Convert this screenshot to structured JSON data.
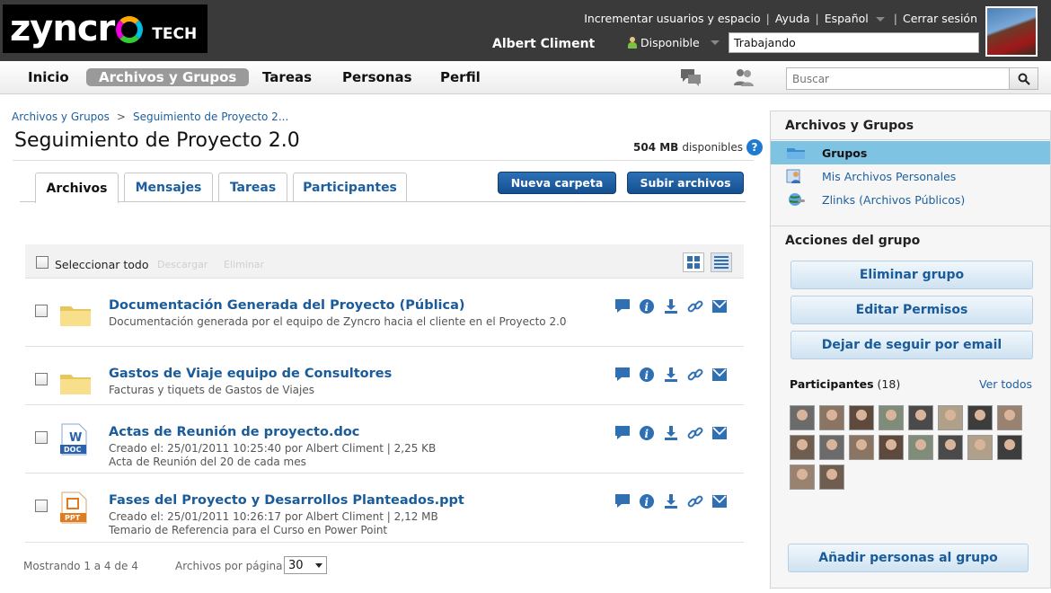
{
  "brand": {
    "logo_text": "zyncro",
    "logo_suffix": "TECH"
  },
  "header": {
    "user_name": "Albert Climent",
    "links": [
      "Incrementar usuarios y espacio",
      "Ayuda",
      "Español",
      "Cerrar sesión"
    ],
    "status_label": "Disponible",
    "status_value": "Trabajando"
  },
  "nav": {
    "items": [
      "Inicio",
      "Archivos y Grupos",
      "Tareas",
      "Personas",
      "Perfil"
    ],
    "active": "Archivos y Grupos",
    "search_placeholder": "Buscar"
  },
  "main": {
    "breadcrumb": [
      "Archivos y Grupos",
      "Seguimiento de Proyecto 2..."
    ],
    "title": "Seguimiento de Proyecto 2.0",
    "space_value": "504 MB",
    "space_label": "disponibles",
    "tabs": [
      "Archivos",
      "Mensajes",
      "Tareas",
      "Participantes"
    ],
    "buttons": {
      "new_folder": "Nueva carpeta",
      "upload": "Subir archivos"
    },
    "toolbar": {
      "select_all": "Seleccionar todo",
      "download": "Descargar",
      "delete": "Eliminar"
    },
    "files": [
      {
        "type": "folder",
        "title": "Documentación Generada del Proyecto (Pública)",
        "lines": [
          "Documentación generada por el equipo de Zyncro hacia el cliente en el Proyecto 2.0"
        ]
      },
      {
        "type": "folder",
        "title": "Gastos de Viaje equipo de Consultores",
        "lines": [
          "Facturas y tiquets de Gastos de Viajes"
        ]
      },
      {
        "type": "doc",
        "badge": "DOC",
        "title": "Actas de Reunión de proyecto.doc",
        "lines": [
          "Creado el: 25/01/2011 10:25:40 por Albert Climent | 2,25 KB",
          "Acta de Reunión del 20 de cada mes"
        ]
      },
      {
        "type": "ppt",
        "badge": "PPT",
        "title": "Fases del Proyecto y Desarrollos Planteados.ppt",
        "lines": [
          "Creado el: 25/01/2011 10:26:17 por Albert Climent | 2,12 MB",
          "Temario de Referencia para el Curso en Power Point"
        ]
      }
    ],
    "footer": {
      "showing": "Mostrando 1 a 4 de 4",
      "per_page_label": "Archivos por página:",
      "per_page_value": "30"
    }
  },
  "sidebar": {
    "section1_title": "Archivos y Grupos",
    "items": [
      "Grupos",
      "Mis Archivos Personales",
      "Zlinks (Archivos Públicos)"
    ],
    "section2_title": "Acciones del grupo",
    "actions": [
      "Eliminar grupo",
      "Editar Permisos",
      "Dejar de seguir por email"
    ],
    "participants_label": "Participantes",
    "participants_count": "(18)",
    "see_all": "Ver todos",
    "add_people": "Añadir personas al grupo"
  },
  "colors": {
    "link": "#1a5b9a",
    "primary_button": "#1e5ea3",
    "active_sidebar": "#7fc3e2",
    "topbar": "#3a3a3a"
  }
}
